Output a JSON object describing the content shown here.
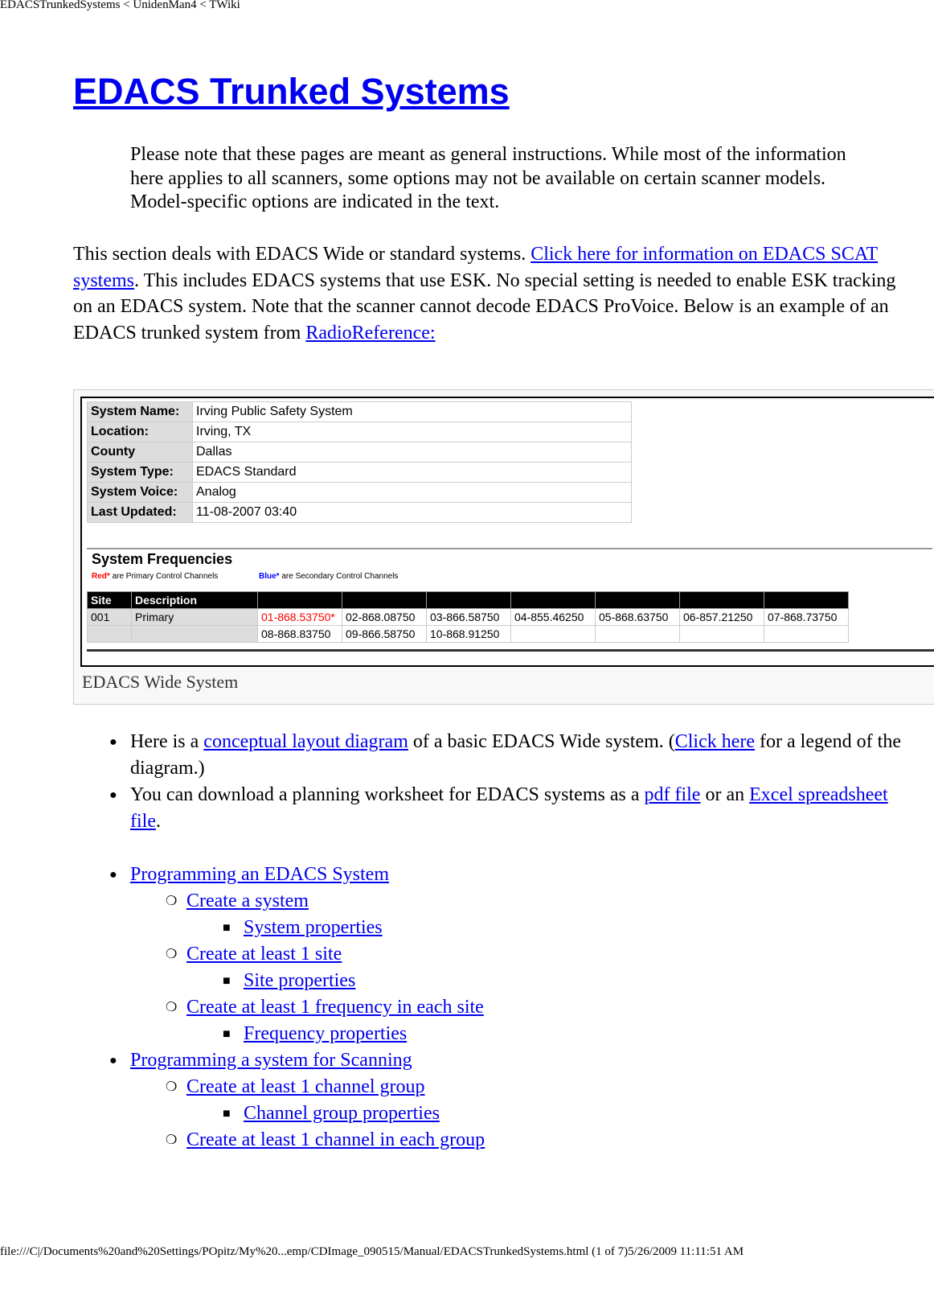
{
  "window_title": "EDACSTrunkedSystems < UnidenMan4 < TWiki",
  "title": "EDACS Trunked Systems",
  "note": "Please note that these pages are meant as general instructions. While most of the information here applies to all scanners, some options may not be available on certain scanner models. Model-specific options are indicated in the text.",
  "para": {
    "t1": "This section deals with EDACS Wide or standard systems. ",
    "link1": "Click here for information on EDACS SCAT systems",
    "t2": ". This includes EDACS systems that use ESK. No special setting is needed to enable ESK tracking on an EDACS system. Note that the scanner cannot decode EDACS ProVoice. Below is an example of an EDACS trunked system from ",
    "link2": "RadioReference:"
  },
  "figure": {
    "info": [
      [
        "System Name:",
        "Irving Public Safety System"
      ],
      [
        "Location:",
        "Irving, TX"
      ],
      [
        "County",
        "Dallas"
      ],
      [
        "System Type:",
        "EDACS Standard"
      ],
      [
        "System Voice:",
        "Analog"
      ],
      [
        "Last Updated:",
        "11-08-2007 03:40"
      ]
    ],
    "freq_title": "System Frequencies",
    "legend_red": "Red*",
    "legend_red_text": " are Primary Control Channels",
    "legend_blue": "Blue*",
    "legend_blue_text": " are Secondary Control Channels",
    "headers": [
      "Site",
      "Description"
    ],
    "site": "001",
    "description": "Primary",
    "row1": [
      "01-868.53750*",
      "02-868.08750",
      "03-866.58750",
      "04-855.46250",
      "05-868.63750",
      "06-857.21250",
      "07-868.73750"
    ],
    "row2": [
      "08-868.83750",
      "09-866.58750",
      "10-868.91250",
      "",
      "",
      "",
      ""
    ],
    "caption": "EDACS Wide System",
    "colors": {
      "primary": "#ff0000",
      "secondary": "#0000ff"
    }
  },
  "bullets": {
    "b1": {
      "t1": "Here is a ",
      "l1": "conceptual layout diagram",
      "t2": " of a basic EDACS Wide system. (",
      "l2": "Click here",
      "t3": " for a legend of the diagram.)"
    },
    "b2": {
      "t1": "You can download a planning worksheet for EDACS systems as a ",
      "l1": "pdf file",
      "t2": " or an ",
      "l2": "Excel spreadsheet file",
      "t3": "."
    }
  },
  "nav": [
    "Programming an EDACS System",
    "Create a system",
    "System properties",
    "Create at least 1 site",
    "Site properties",
    "Create at least 1 frequency in each site",
    "Frequency properties",
    "Programming a system for Scanning",
    "Create at least 1 channel group",
    "Channel group properties",
    "Create at least 1 channel in each group"
  ],
  "footer": "file:///C|/Documents%20and%20Settings/POpitz/My%20...emp/CDImage_090515/Manual/EDACSTrunkedSystems.html (1 of 7)5/26/2009 11:11:51 AM"
}
